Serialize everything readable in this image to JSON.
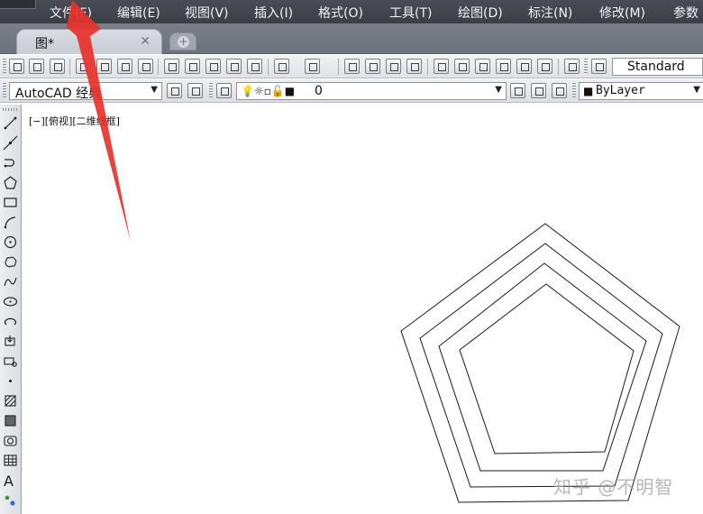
{
  "menubar": {
    "items": [
      "文件(F)",
      "编辑(E)",
      "视图(V)",
      "插入(I)",
      "格式(O)",
      "工具(T)",
      "绘图(D)",
      "标注(N)",
      "修改(M)",
      "参数"
    ]
  },
  "tabs": [
    {
      "label": "图*",
      "close": "✕"
    }
  ],
  "toolbar": {
    "text_style": "Standard",
    "workspace": "AutoCAD 经典",
    "layer": "0",
    "linetype": "ByLayer"
  },
  "viewport": {
    "label": "[−][俯视][二维线框]"
  },
  "lefttool": {
    "text_tool": "A"
  },
  "watermark": {
    "text": "知乎 @不明智"
  },
  "colors": {
    "annotation_arrow": "#e8312a",
    "menubar_bg": "#3f424a",
    "canvas_bg": "#ffffff",
    "stroke": "#1a1a1a"
  }
}
